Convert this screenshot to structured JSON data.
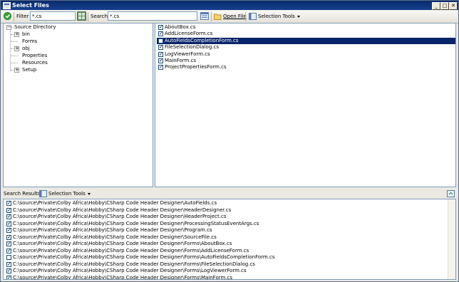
{
  "window": {
    "title": "Select Files",
    "buttons": {
      "minimize": "_",
      "maximize": "□",
      "close": "✕"
    }
  },
  "toolbar": {
    "filter_label": "Filter",
    "filter_value": "*.cs",
    "search_label": "Search",
    "search_value": "*.cs",
    "open_file_label": "Open File",
    "selection_tools_label": "Selection Tools"
  },
  "tree": {
    "root": "Source Directory",
    "items": [
      {
        "label": "bin",
        "expandable": true
      },
      {
        "label": "Forms",
        "expandable": false
      },
      {
        "label": "obj",
        "expandable": true
      },
      {
        "label": "Properties",
        "expandable": false
      },
      {
        "label": "Resources",
        "expandable": false
      },
      {
        "label": "Setup",
        "expandable": true
      }
    ]
  },
  "files": [
    {
      "name": "AboutBox.cs",
      "checked": true,
      "selected": false
    },
    {
      "name": "AddLicenseForm.cs",
      "checked": true,
      "selected": false
    },
    {
      "name": "AutoFieldsCompletionForm.cs",
      "checked": false,
      "selected": true
    },
    {
      "name": "FileSelectionDialog.cs",
      "checked": true,
      "selected": false
    },
    {
      "name": "LogViewerForm.cs",
      "checked": true,
      "selected": false
    },
    {
      "name": "MainForm.cs",
      "checked": true,
      "selected": false
    },
    {
      "name": "ProjectPropertiesForm.cs",
      "checked": true,
      "selected": false
    }
  ],
  "results": {
    "label": "Search Results",
    "selection_tools_label": "Selection Tools",
    "rows": [
      {
        "path": "C:\\source\\Private\\Colby Africa\\Hobby\\CSharp Code Header Designer\\AutoFields.cs",
        "checked": true
      },
      {
        "path": "C:\\source\\Private\\Colby Africa\\Hobby\\CSharp Code Header Designer\\HeaderDesigner.cs",
        "checked": true
      },
      {
        "path": "C:\\source\\Private\\Colby Africa\\Hobby\\CSharp Code Header Designer\\HeaderProject.cs",
        "checked": true
      },
      {
        "path": "C:\\source\\Private\\Colby Africa\\Hobby\\CSharp Code Header Designer\\ProcessingStatusEventArgs.cs",
        "checked": true
      },
      {
        "path": "C:\\source\\Private\\Colby Africa\\Hobby\\CSharp Code Header Designer\\Program.cs",
        "checked": true
      },
      {
        "path": "C:\\source\\Private\\Colby Africa\\Hobby\\CSharp Code Header Designer\\SourceFile.cs",
        "checked": true
      },
      {
        "path": "C:\\source\\Private\\Colby Africa\\Hobby\\CSharp Code Header Designer\\Forms\\AboutBox.cs",
        "checked": true
      },
      {
        "path": "C:\\source\\Private\\Colby Africa\\Hobby\\CSharp Code Header Designer\\Forms\\AddLicenseForm.cs",
        "checked": true
      },
      {
        "path": "C:\\source\\Private\\Colby Africa\\Hobby\\CSharp Code Header Designer\\Forms\\AutoFieldsCompletionForm.cs",
        "checked": false
      },
      {
        "path": "C:\\source\\Private\\Colby Africa\\Hobby\\CSharp Code Header Designer\\Forms\\FileSelectionDialog.cs",
        "checked": true
      },
      {
        "path": "C:\\source\\Private\\Colby Africa\\Hobby\\CSharp Code Header Designer\\Forms\\LogViewerForm.cs",
        "checked": true
      },
      {
        "path": "C:\\source\\Private\\Colby Africa\\Hobby\\CSharp Code Header Designer\\Forms\\MainForm.cs",
        "checked": true
      }
    ]
  },
  "colors": {
    "title_bar": "#0a2a6b",
    "selection": "#0a246a",
    "accept_green": "#3aa63a"
  },
  "icons": [
    "accept-icon",
    "filter-grid-icon",
    "search-options-icon",
    "open-folder-icon",
    "selection-tools-icon",
    "refresh-icon"
  ]
}
